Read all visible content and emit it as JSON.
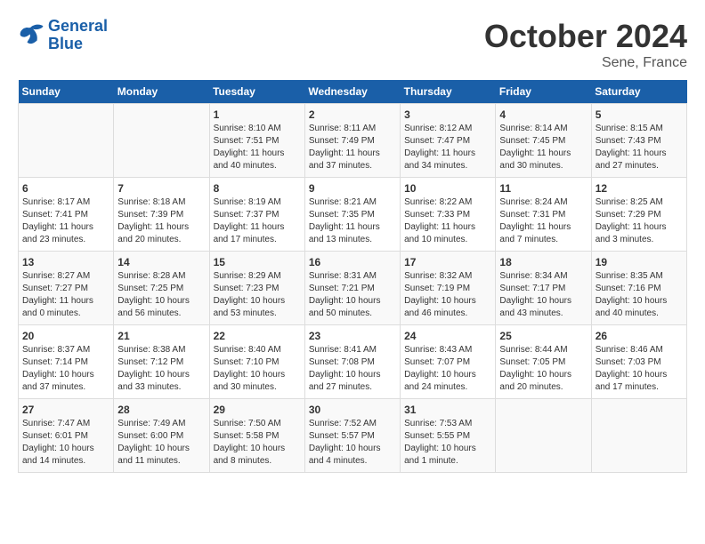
{
  "logo": {
    "line1": "General",
    "line2": "Blue"
  },
  "title": "October 2024",
  "subtitle": "Sene, France",
  "days_header": [
    "Sunday",
    "Monday",
    "Tuesday",
    "Wednesday",
    "Thursday",
    "Friday",
    "Saturday"
  ],
  "weeks": [
    [
      {
        "day": "",
        "info": ""
      },
      {
        "day": "",
        "info": ""
      },
      {
        "day": "1",
        "info": "Sunrise: 8:10 AM\nSunset: 7:51 PM\nDaylight: 11 hours and 40 minutes."
      },
      {
        "day": "2",
        "info": "Sunrise: 8:11 AM\nSunset: 7:49 PM\nDaylight: 11 hours and 37 minutes."
      },
      {
        "day": "3",
        "info": "Sunrise: 8:12 AM\nSunset: 7:47 PM\nDaylight: 11 hours and 34 minutes."
      },
      {
        "day": "4",
        "info": "Sunrise: 8:14 AM\nSunset: 7:45 PM\nDaylight: 11 hours and 30 minutes."
      },
      {
        "day": "5",
        "info": "Sunrise: 8:15 AM\nSunset: 7:43 PM\nDaylight: 11 hours and 27 minutes."
      }
    ],
    [
      {
        "day": "6",
        "info": "Sunrise: 8:17 AM\nSunset: 7:41 PM\nDaylight: 11 hours and 23 minutes."
      },
      {
        "day": "7",
        "info": "Sunrise: 8:18 AM\nSunset: 7:39 PM\nDaylight: 11 hours and 20 minutes."
      },
      {
        "day": "8",
        "info": "Sunrise: 8:19 AM\nSunset: 7:37 PM\nDaylight: 11 hours and 17 minutes."
      },
      {
        "day": "9",
        "info": "Sunrise: 8:21 AM\nSunset: 7:35 PM\nDaylight: 11 hours and 13 minutes."
      },
      {
        "day": "10",
        "info": "Sunrise: 8:22 AM\nSunset: 7:33 PM\nDaylight: 11 hours and 10 minutes."
      },
      {
        "day": "11",
        "info": "Sunrise: 8:24 AM\nSunset: 7:31 PM\nDaylight: 11 hours and 7 minutes."
      },
      {
        "day": "12",
        "info": "Sunrise: 8:25 AM\nSunset: 7:29 PM\nDaylight: 11 hours and 3 minutes."
      }
    ],
    [
      {
        "day": "13",
        "info": "Sunrise: 8:27 AM\nSunset: 7:27 PM\nDaylight: 11 hours and 0 minutes."
      },
      {
        "day": "14",
        "info": "Sunrise: 8:28 AM\nSunset: 7:25 PM\nDaylight: 10 hours and 56 minutes."
      },
      {
        "day": "15",
        "info": "Sunrise: 8:29 AM\nSunset: 7:23 PM\nDaylight: 10 hours and 53 minutes."
      },
      {
        "day": "16",
        "info": "Sunrise: 8:31 AM\nSunset: 7:21 PM\nDaylight: 10 hours and 50 minutes."
      },
      {
        "day": "17",
        "info": "Sunrise: 8:32 AM\nSunset: 7:19 PM\nDaylight: 10 hours and 46 minutes."
      },
      {
        "day": "18",
        "info": "Sunrise: 8:34 AM\nSunset: 7:17 PM\nDaylight: 10 hours and 43 minutes."
      },
      {
        "day": "19",
        "info": "Sunrise: 8:35 AM\nSunset: 7:16 PM\nDaylight: 10 hours and 40 minutes."
      }
    ],
    [
      {
        "day": "20",
        "info": "Sunrise: 8:37 AM\nSunset: 7:14 PM\nDaylight: 10 hours and 37 minutes."
      },
      {
        "day": "21",
        "info": "Sunrise: 8:38 AM\nSunset: 7:12 PM\nDaylight: 10 hours and 33 minutes."
      },
      {
        "day": "22",
        "info": "Sunrise: 8:40 AM\nSunset: 7:10 PM\nDaylight: 10 hours and 30 minutes."
      },
      {
        "day": "23",
        "info": "Sunrise: 8:41 AM\nSunset: 7:08 PM\nDaylight: 10 hours and 27 minutes."
      },
      {
        "day": "24",
        "info": "Sunrise: 8:43 AM\nSunset: 7:07 PM\nDaylight: 10 hours and 24 minutes."
      },
      {
        "day": "25",
        "info": "Sunrise: 8:44 AM\nSunset: 7:05 PM\nDaylight: 10 hours and 20 minutes."
      },
      {
        "day": "26",
        "info": "Sunrise: 8:46 AM\nSunset: 7:03 PM\nDaylight: 10 hours and 17 minutes."
      }
    ],
    [
      {
        "day": "27",
        "info": "Sunrise: 7:47 AM\nSunset: 6:01 PM\nDaylight: 10 hours and 14 minutes."
      },
      {
        "day": "28",
        "info": "Sunrise: 7:49 AM\nSunset: 6:00 PM\nDaylight: 10 hours and 11 minutes."
      },
      {
        "day": "29",
        "info": "Sunrise: 7:50 AM\nSunset: 5:58 PM\nDaylight: 10 hours and 8 minutes."
      },
      {
        "day": "30",
        "info": "Sunrise: 7:52 AM\nSunset: 5:57 PM\nDaylight: 10 hours and 4 minutes."
      },
      {
        "day": "31",
        "info": "Sunrise: 7:53 AM\nSunset: 5:55 PM\nDaylight: 10 hours and 1 minute."
      },
      {
        "day": "",
        "info": ""
      },
      {
        "day": "",
        "info": ""
      }
    ]
  ]
}
